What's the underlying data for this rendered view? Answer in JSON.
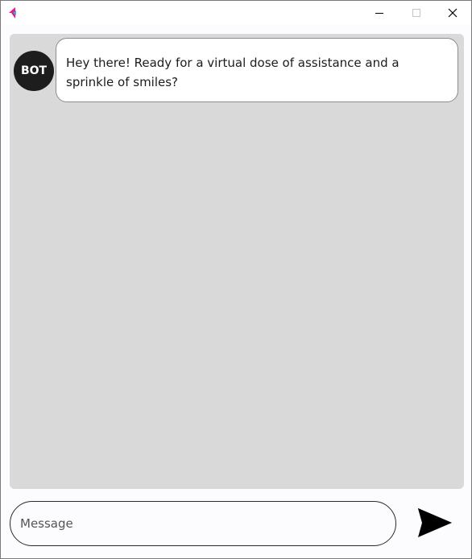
{
  "titlebar": {
    "app_icon": "flutter-logo-icon",
    "minimize_icon": "minimize-icon",
    "maximize_icon": "maximize-icon",
    "close_icon": "close-icon"
  },
  "chat": {
    "messages": [
      {
        "sender": "BOT",
        "text": "Hey there! Ready for a virtual dose of assistance and a sprinkle of smiles?"
      }
    ]
  },
  "composer": {
    "placeholder": "Message",
    "value": "",
    "send_icon": "send-icon"
  },
  "colors": {
    "chat_background": "#d9d9d9",
    "avatar_background": "#1d1d1d",
    "bubble_background": "#ffffff",
    "window_background": "#fcfcff"
  }
}
